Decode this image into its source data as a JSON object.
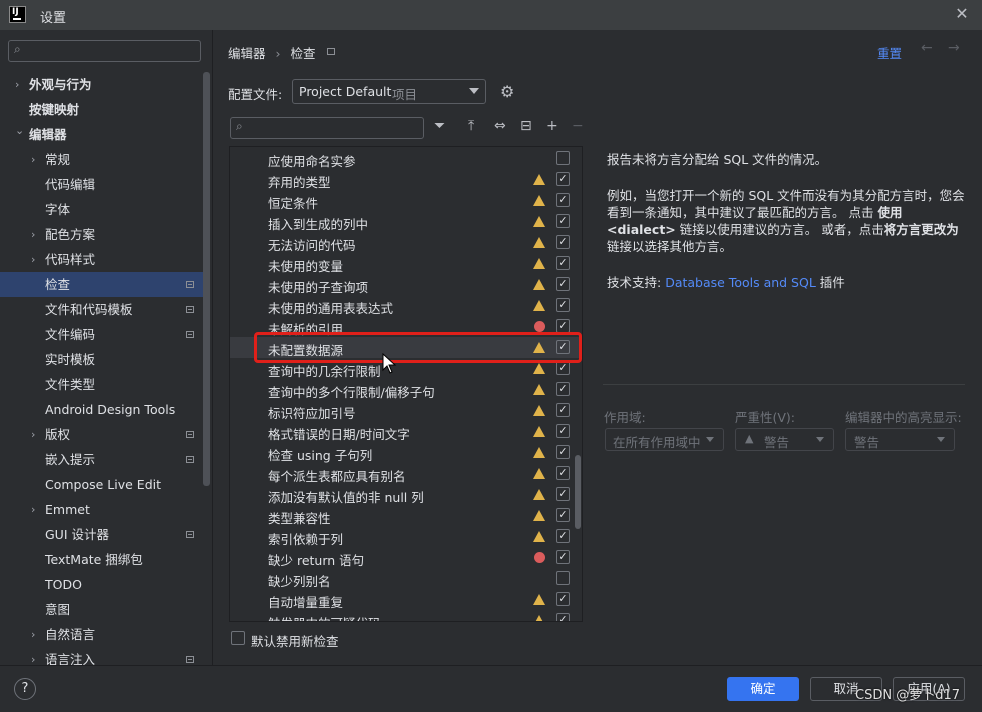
{
  "window": {
    "title": "设置",
    "app_icon_text": "IJ",
    "close_icon": "close-icon"
  },
  "sidebar": {
    "search_placeholder": "",
    "items": [
      {
        "label": "外观与行为",
        "bold": true,
        "expandable": true,
        "level": 0
      },
      {
        "label": "按键映射",
        "bold": true,
        "expandable": false,
        "level": 0
      },
      {
        "label": "编辑器",
        "bold": true,
        "expandable": true,
        "expanded": true,
        "level": 0
      },
      {
        "label": "常规",
        "expandable": true,
        "level": 1
      },
      {
        "label": "代码编辑",
        "level": 1
      },
      {
        "label": "字体",
        "level": 1
      },
      {
        "label": "配色方案",
        "expandable": true,
        "level": 1
      },
      {
        "label": "代码样式",
        "expandable": true,
        "level": 1
      },
      {
        "label": "检查",
        "level": 1,
        "selected": true,
        "project_mark": true
      },
      {
        "label": "文件和代码模板",
        "level": 1,
        "project_mark": true
      },
      {
        "label": "文件编码",
        "level": 1,
        "project_mark": true
      },
      {
        "label": "实时模板",
        "level": 1
      },
      {
        "label": "文件类型",
        "level": 1
      },
      {
        "label": "Android Design Tools",
        "level": 1
      },
      {
        "label": "版权",
        "expandable": true,
        "level": 1,
        "project_mark": true
      },
      {
        "label": "嵌入提示",
        "level": 1,
        "project_mark": true
      },
      {
        "label": "Compose Live Edit",
        "level": 1
      },
      {
        "label": "Emmet",
        "expandable": true,
        "level": 1
      },
      {
        "label": "GUI 设计器",
        "level": 1,
        "project_mark": true
      },
      {
        "label": "TextMate 捆绑包",
        "level": 1
      },
      {
        "label": "TODO",
        "level": 1
      },
      {
        "label": "意图",
        "level": 1
      },
      {
        "label": "自然语言",
        "expandable": true,
        "level": 1
      },
      {
        "label": "语言注入",
        "expandable": true,
        "level": 1,
        "project_mark": true
      }
    ]
  },
  "header": {
    "breadcrumb_parent": "编辑器",
    "breadcrumb_sep": "›",
    "breadcrumb_current": "检查",
    "reset_label": "重置",
    "back_icon": "←",
    "forward_icon": "→"
  },
  "profile": {
    "label": "配置文件:",
    "value": "Project Default",
    "scope": "项目"
  },
  "toolbar": {
    "icons": [
      "filter-icon",
      "expand-all-icon",
      "collapse-all-icon",
      "reset-icon",
      "add-icon",
      "remove-icon"
    ]
  },
  "tree": {
    "rows": [
      {
        "name": "应使用命名实参",
        "severity": "none",
        "checked": false
      },
      {
        "name": "弃用的类型",
        "severity": "warning",
        "checked": true
      },
      {
        "name": "恒定条件",
        "severity": "warning",
        "checked": true
      },
      {
        "name": "插入到生成的列中",
        "severity": "warning",
        "checked": true
      },
      {
        "name": "无法访问的代码",
        "severity": "warning",
        "checked": true
      },
      {
        "name": "未使用的变量",
        "severity": "warning",
        "checked": true
      },
      {
        "name": "未使用的子查询项",
        "severity": "warning",
        "checked": true
      },
      {
        "name": "未使用的通用表表达式",
        "severity": "warning",
        "checked": true
      },
      {
        "name": "未解析的引用",
        "severity": "error",
        "checked": true
      },
      {
        "name": "未配置数据源",
        "severity": "warning",
        "checked": true,
        "selected": true
      },
      {
        "name": "查询中的几余行限制",
        "severity": "warning",
        "checked": true
      },
      {
        "name": "查询中的多个行限制/偏移子句",
        "severity": "warning",
        "checked": true
      },
      {
        "name": "标识符应加引号",
        "severity": "warning",
        "checked": true
      },
      {
        "name": "格式错误的日期/时间文字",
        "severity": "warning",
        "checked": true
      },
      {
        "name": "检查 using 子句列",
        "severity": "warning",
        "checked": true
      },
      {
        "name": "每个派生表都应具有别名",
        "severity": "warning",
        "checked": true
      },
      {
        "name": "添加没有默认值的非 null 列",
        "severity": "warning",
        "checked": true
      },
      {
        "name": "类型兼容性",
        "severity": "warning",
        "checked": true
      },
      {
        "name": "索引依赖于列",
        "severity": "warning",
        "checked": true
      },
      {
        "name": "缺少 return 语句",
        "severity": "error",
        "checked": true
      },
      {
        "name": "缺少列别名",
        "severity": "none",
        "checked": false
      },
      {
        "name": "自动增量重复",
        "severity": "warning",
        "checked": true
      },
      {
        "name": "触发器中的可疑代码",
        "severity": "warning",
        "checked": true
      }
    ],
    "default_disable_label": "默认禁用新检查"
  },
  "description": {
    "p1": "报告未将方言分配给 SQL 文件的情况。",
    "p2_a": "例如，当您打开一个新的 SQL 文件而没有为其分配方言时，您会看到一条通知，其中建议了最匹配的方言。 点击 ",
    "p2_b": "使用<dialect>",
    "p2_c": " 链接以使用建议的方言。 或者，点击",
    "p2_d": "将方言更改为",
    "p2_e": "链接以选择其他方言。",
    "tech_label": "技术支持: ",
    "tech_link": "Database Tools and SQL",
    "tech_suffix": " 插件"
  },
  "options": {
    "scope_label": "作用域:",
    "scope_value": "在所有作用域中",
    "severity_label": "严重性(V):",
    "severity_value": "警告",
    "highlight_label": "编辑器中的高亮显示:",
    "highlight_value": "警告"
  },
  "footer": {
    "help": "?",
    "ok": "确定",
    "cancel": "取消",
    "apply": "应用(A)"
  },
  "watermark": "CSDN @萝卜d17",
  "colors": {
    "accent": "#3574f0",
    "link": "#548af7",
    "warning": "#e0b34a",
    "error": "#db5c5c",
    "highlight_box": "#e0201a"
  }
}
